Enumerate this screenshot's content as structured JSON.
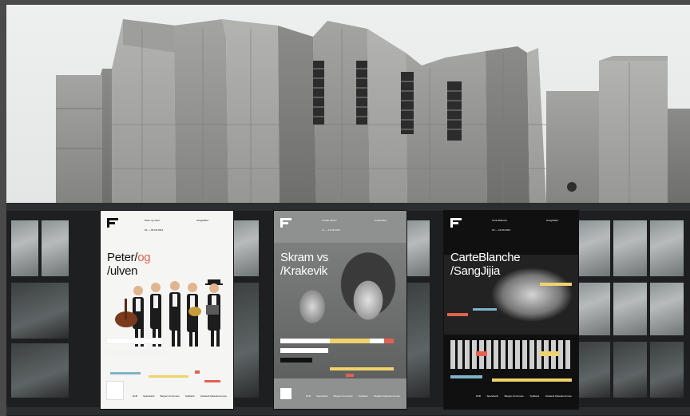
{
  "scene": {
    "description_free": true,
    "colors": {
      "concrete": "#9a9b99",
      "facade": "#1d1f20",
      "sky": "#eceeee",
      "accent_red": "#e2614f",
      "accent_yellow": "#f0d36a"
    }
  },
  "posters": [
    {
      "title_line1": "Peter/",
      "title_accent": "og",
      "title_line2": "/ulven",
      "meta_left": "Peter og ulven",
      "meta_mid": "Framtid",
      "meta_right": "Grieghallen",
      "date": "04 — 05.09.2024",
      "sponsors": [
        "DnB",
        "Sparebank",
        "Bergen Kommune",
        "Sydbank",
        "Vestland fylkeskommune"
      ],
      "accent_color": "#e2614f",
      "bar_colors": [
        "#f0d36a",
        "#e2614f",
        "#7fb3c7",
        "#cfcfcf"
      ]
    },
    {
      "title_line1": "Skram vs",
      "title_line2": "/Krakevik",
      "meta_left": "Amalie Skram",
      "meta_mid": "Krakevik",
      "meta_right": "Grieghallen",
      "date": "11 — 12.09.2024",
      "sponsors": [
        "DnB",
        "Sparebank",
        "Bergen Kommune",
        "Sydbank",
        "Vestland fylkeskommune"
      ],
      "accent_color": "#e2614f",
      "bar_colors": [
        "#f0d36a",
        "#e2614f",
        "#ffffff",
        "#cfcfcf"
      ]
    },
    {
      "title_line1": "CarteBlanche",
      "title_line2": "/SangJijia",
      "meta_left": "Carte Blanche",
      "meta_mid": "SangJijia",
      "meta_right": "Grieghallen",
      "date": "18 — 19.09.2024",
      "sponsors": [
        "DnB",
        "Sparebank",
        "Bergen Kommune",
        "Sydbank",
        "Vestland fylkeskommune"
      ],
      "accent_color": "#e2614f",
      "bar_colors": [
        "#f0d36a",
        "#e2614f",
        "#7fb3c7",
        "#ffffff"
      ]
    }
  ]
}
